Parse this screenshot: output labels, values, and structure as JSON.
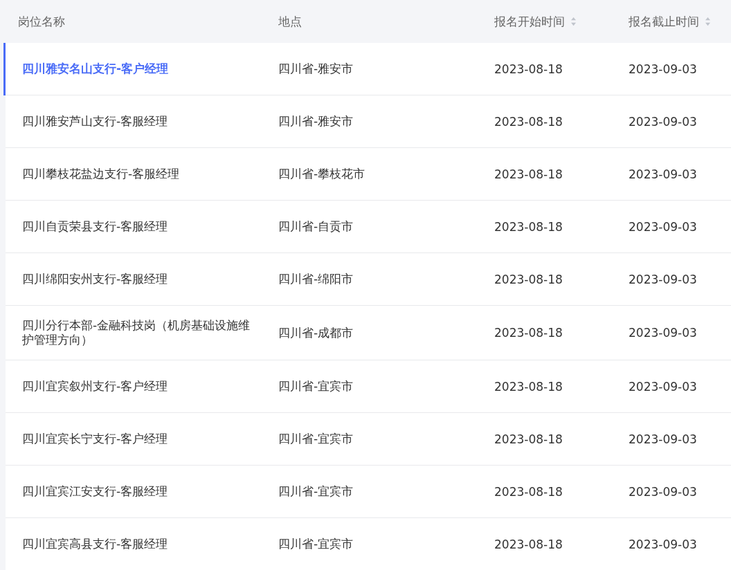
{
  "table": {
    "columns": [
      {
        "label": "岗位名称",
        "sortable": false
      },
      {
        "label": "地点",
        "sortable": false
      },
      {
        "label": "报名开始时间",
        "sortable": true
      },
      {
        "label": "报名截止时间",
        "sortable": true
      }
    ],
    "rows": [
      {
        "name": "四川雅安名山支行-客户经理",
        "location": "四川省-雅安市",
        "start": "2023-08-18",
        "end": "2023-09-03",
        "selected": true
      },
      {
        "name": "四川雅安芦山支行-客服经理",
        "location": "四川省-雅安市",
        "start": "2023-08-18",
        "end": "2023-09-03",
        "selected": false
      },
      {
        "name": "四川攀枝花盐边支行-客服经理",
        "location": "四川省-攀枝花市",
        "start": "2023-08-18",
        "end": "2023-09-03",
        "selected": false
      },
      {
        "name": "四川自贡荣县支行-客服经理",
        "location": "四川省-自贡市",
        "start": "2023-08-18",
        "end": "2023-09-03",
        "selected": false
      },
      {
        "name": "四川绵阳安州支行-客服经理",
        "location": "四川省-绵阳市",
        "start": "2023-08-18",
        "end": "2023-09-03",
        "selected": false
      },
      {
        "name": "四川分行本部-金融科技岗（机房基础设施维护管理方向）",
        "location": "四川省-成都市",
        "start": "2023-08-18",
        "end": "2023-09-03",
        "selected": false
      },
      {
        "name": "四川宜宾叙州支行-客户经理",
        "location": "四川省-宜宾市",
        "start": "2023-08-18",
        "end": "2023-09-03",
        "selected": false
      },
      {
        "name": "四川宜宾长宁支行-客户经理",
        "location": "四川省-宜宾市",
        "start": "2023-08-18",
        "end": "2023-09-03",
        "selected": false
      },
      {
        "name": "四川宜宾江安支行-客服经理",
        "location": "四川省-宜宾市",
        "start": "2023-08-18",
        "end": "2023-09-03",
        "selected": false
      },
      {
        "name": "四川宜宾高县支行-客服经理",
        "location": "四川省-宜宾市",
        "start": "2023-08-18",
        "end": "2023-09-03",
        "selected": false
      }
    ]
  }
}
